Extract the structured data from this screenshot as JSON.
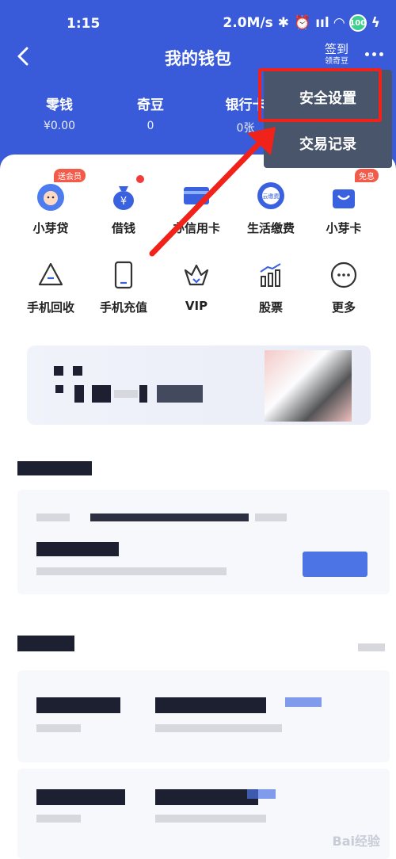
{
  "status": {
    "time": "1:15",
    "speed": "2.0M/s",
    "battery": "100"
  },
  "nav": {
    "title": "我的钱包",
    "signin": "签到",
    "signin_sub": "领奇豆"
  },
  "balances": [
    {
      "label": "零钱",
      "value": "¥0.00"
    },
    {
      "label": "奇豆",
      "value": "0"
    },
    {
      "label": "银行卡",
      "value": "0张"
    }
  ],
  "services_row1": [
    {
      "label": "小芽贷",
      "icon": "baby-face-icon",
      "tag": "送会员"
    },
    {
      "label": "借钱",
      "icon": "money-bag-icon",
      "tag": ""
    },
    {
      "label": "办信用卡",
      "icon": "credit-card-icon",
      "tag": ""
    },
    {
      "label": "生活缴费",
      "icon": "utility-bill-icon",
      "tag": "",
      "badge_text": "云缴费"
    },
    {
      "label": "小芽卡",
      "icon": "shopping-bag-icon",
      "tag": "免息"
    }
  ],
  "services_row2": [
    {
      "label": "手机回收",
      "icon": "recycle-icon"
    },
    {
      "label": "手机充值",
      "icon": "phone-icon"
    },
    {
      "label": "VIP",
      "icon": "crown-icon"
    },
    {
      "label": "股票",
      "icon": "stock-chart-icon"
    },
    {
      "label": "更多",
      "icon": "more-circle-icon"
    }
  ],
  "menu": {
    "items": [
      "安全设置",
      "交易记录"
    ]
  },
  "watermark": "Bai经验",
  "colors": {
    "header": "#3a5bd9",
    "menu_bg": "#48556a",
    "highlight": "#f0221a",
    "tag": "#f25b4a"
  }
}
